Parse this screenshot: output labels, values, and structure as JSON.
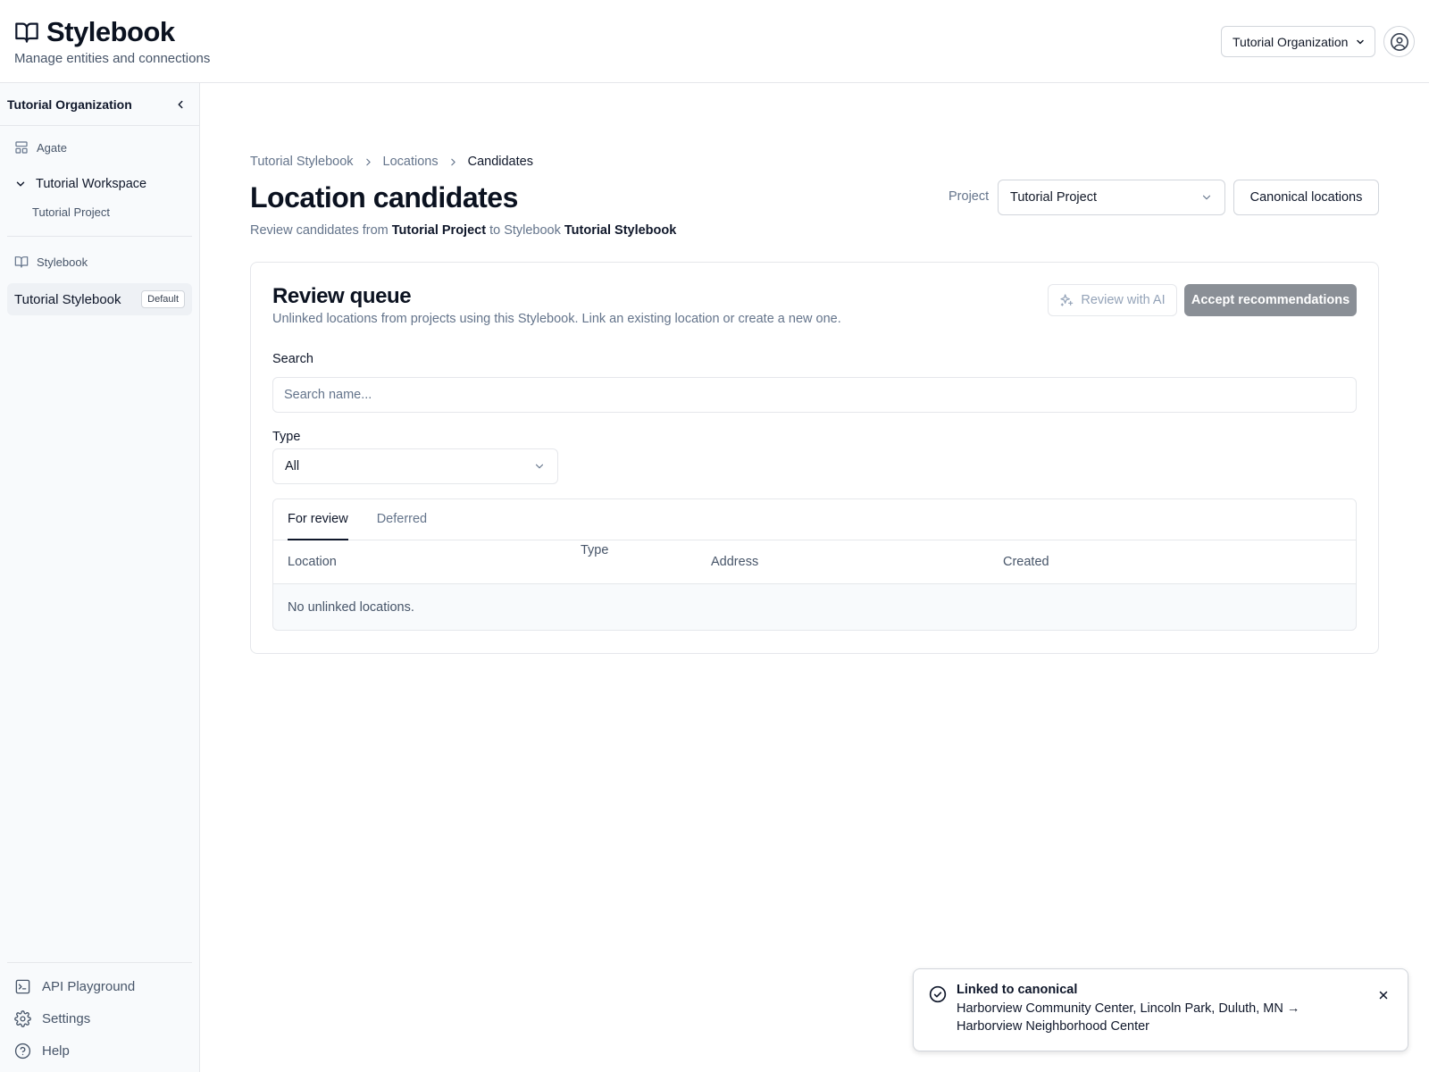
{
  "header": {
    "title": "Stylebook",
    "subtitle": "Manage entities and connections",
    "org_select": "Tutorial Organization",
    "icons": {
      "logo": "book-open-icon",
      "account": "user-circle-icon"
    }
  },
  "sidebar": {
    "org_name": "Tutorial Organization",
    "agate_label": "Agate",
    "workspace_label": "Tutorial Workspace",
    "project_label": "Tutorial Project",
    "stylebook_section_label": "Stylebook",
    "stylebook_item": "Tutorial Stylebook",
    "stylebook_badge": "Default",
    "bottom": {
      "api_playground": "API Playground",
      "settings": "Settings",
      "help": "Help"
    }
  },
  "breadcrumb": {
    "item1": "Tutorial Stylebook",
    "item2": "Locations",
    "item3": "Candidates"
  },
  "page": {
    "title": "Location candidates",
    "desc_prefix": "Review candidates from ",
    "desc_project": "Tutorial Project",
    "desc_mid": " to Stylebook ",
    "desc_stylebook": "Tutorial Stylebook",
    "project_label": "Project",
    "project_value": "Tutorial Project",
    "canonical_button": "Canonical locations"
  },
  "review_queue": {
    "title": "Review queue",
    "description": "Unlinked locations from projects using this Stylebook. Link an existing location or create a new one.",
    "ai_button": "Review with AI",
    "accept_button": "Accept recommendations",
    "search_label": "Search",
    "search_placeholder": "Search name...",
    "type_label": "Type",
    "type_value": "All",
    "tabs": [
      "For review",
      "Deferred"
    ],
    "columns": [
      "Location",
      "Type",
      "Address",
      "Created"
    ],
    "empty_message": "No unlinked locations."
  },
  "toast": {
    "title": "Linked to canonical",
    "line1": "Harborview Community Center, Lincoln Park, Duluth, MN →",
    "line2": "Harborview Neighborhood Center"
  }
}
